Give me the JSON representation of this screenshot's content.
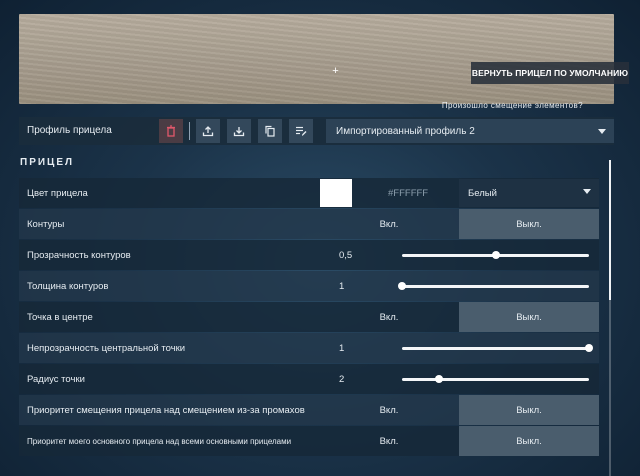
{
  "preview": {
    "crosshair_glyph": "+",
    "reset_button": "ВЕРНУТЬ ПРИЦЕЛ ПО УМОЛЧАНИЮ",
    "offset_link": "Произошло смещение элементов?"
  },
  "profile": {
    "label": "Профиль прицела",
    "selected": "Импортированный профиль 2",
    "icons": [
      "trash-icon",
      "upload-icon",
      "download-icon",
      "copy-icon",
      "edit-icon"
    ]
  },
  "section": {
    "title": "ПРИЦЕЛ"
  },
  "rows": {
    "color": {
      "label": "Цвет прицела",
      "swatch": "#FFFFFF",
      "hex": "#FFFFFF",
      "select": "Белый"
    },
    "outlines": {
      "label": "Контуры",
      "on": "Вкл.",
      "off": "Выкл.",
      "selected": "off"
    },
    "outline_opacity": {
      "label": "Прозрачность контуров",
      "value": "0,5",
      "fraction": 0.5
    },
    "outline_thickness": {
      "label": "Толщина контуров",
      "value": "1",
      "fraction": 0.0
    },
    "center_dot": {
      "label": "Точка в центре",
      "on": "Вкл.",
      "off": "Выкл.",
      "selected": "off"
    },
    "center_dot_opacity": {
      "label": "Непрозрачность центральной точки",
      "value": "1",
      "fraction": 1.0
    },
    "dot_radius": {
      "label": "Радиус точки",
      "value": "2",
      "fraction": 0.2
    },
    "fire_error_priority": {
      "label": "Приоритет смещения прицела над смещением из-за промахов",
      "on": "Вкл.",
      "off": "Выкл.",
      "selected": "off"
    },
    "primary_priority": {
      "label": "Приоритет моего основного прицела над всеми основными прицелами",
      "on": "Вкл.",
      "off": "Выкл.",
      "selected": "off"
    }
  },
  "colors": {
    "accent_selected": "#4a5d6d",
    "slider": "#f4f6f8"
  }
}
